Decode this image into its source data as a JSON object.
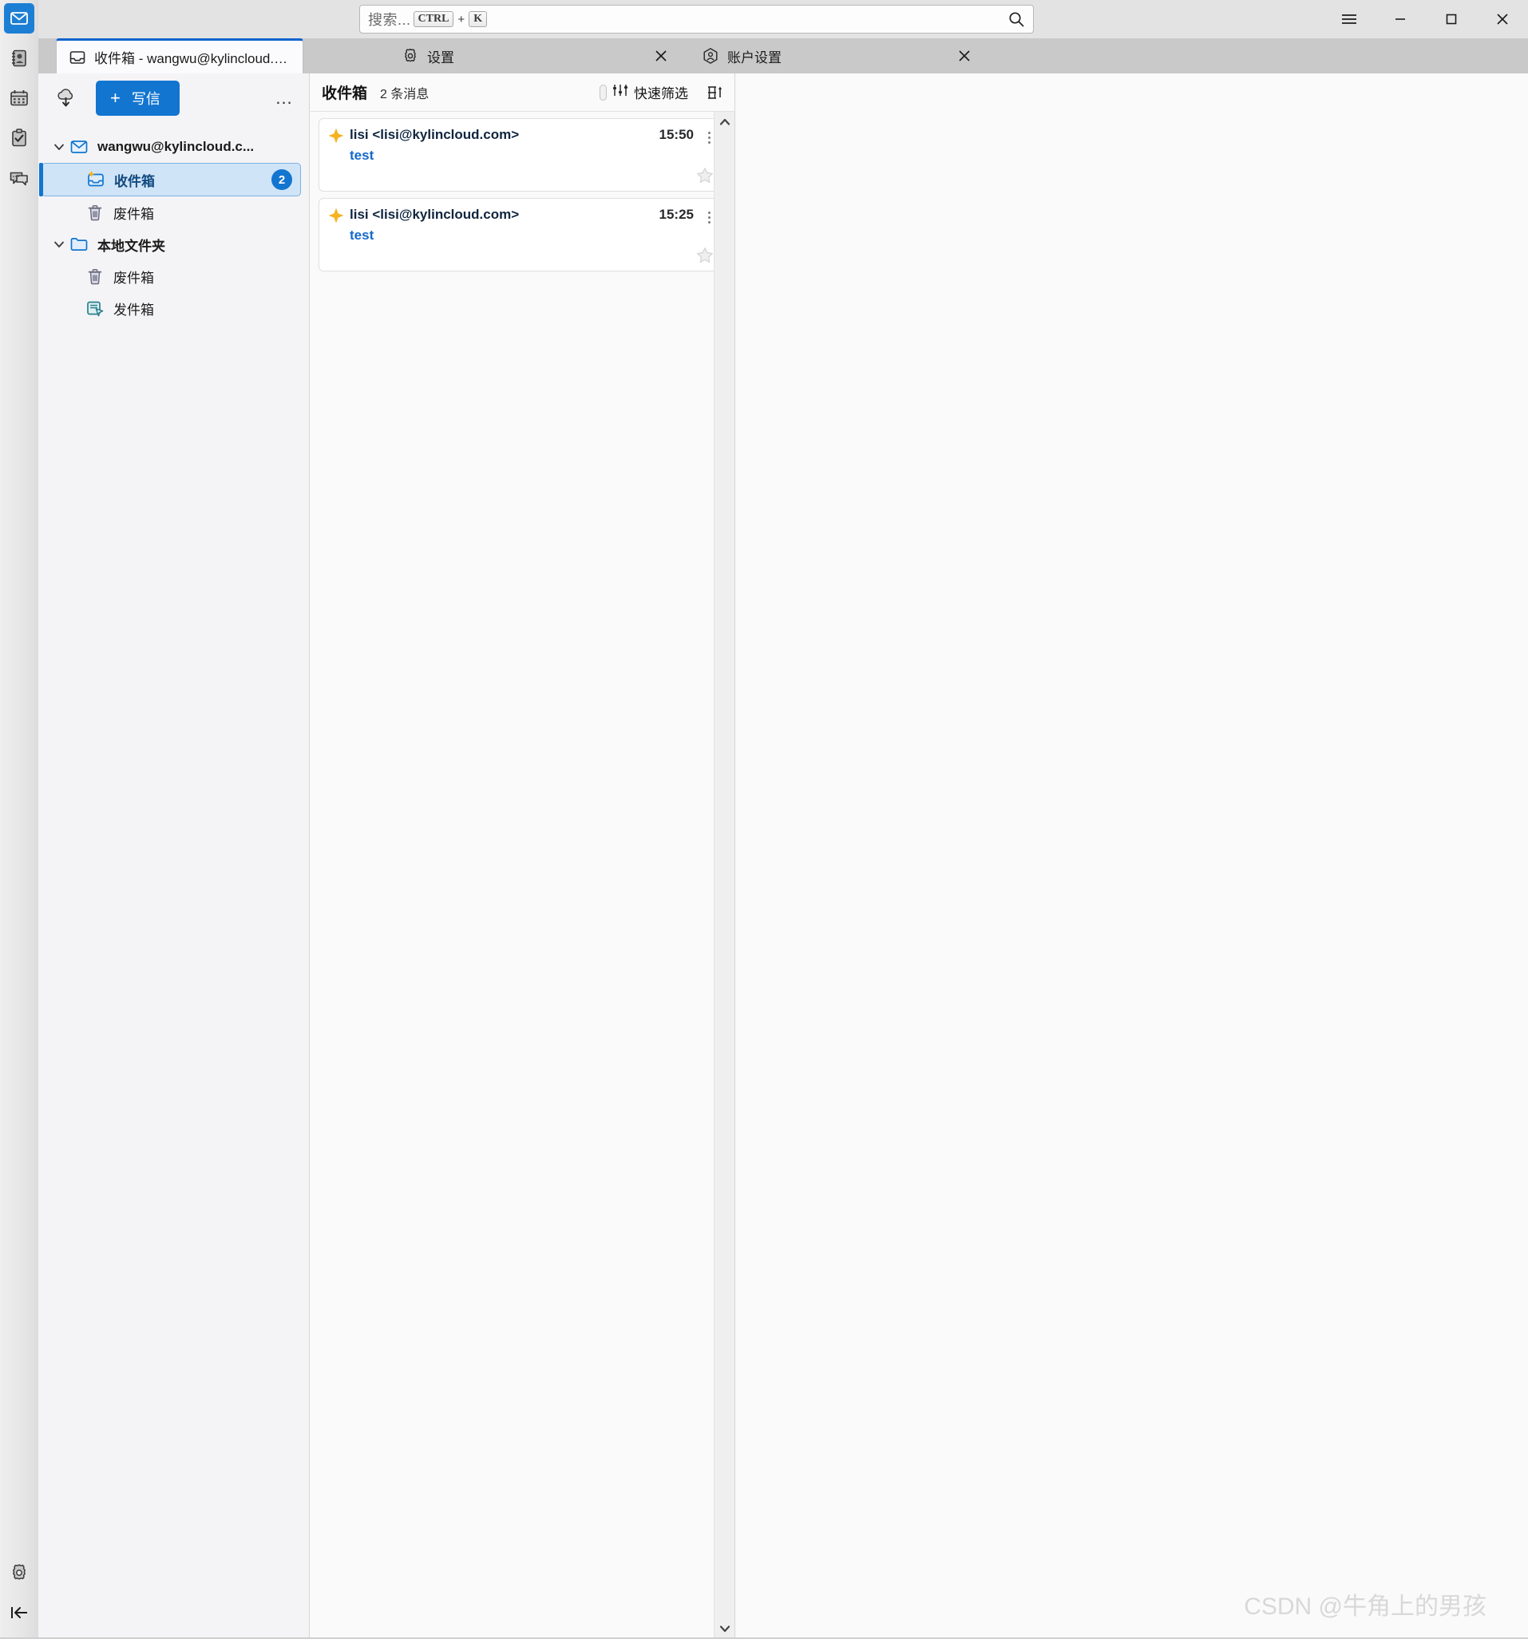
{
  "window": {
    "controls": [
      {
        "name": "menu",
        "glyph": "hamburger"
      },
      {
        "name": "minimize",
        "glyph": "minimize"
      },
      {
        "name": "maximize",
        "glyph": "maximize"
      },
      {
        "name": "close",
        "glyph": "close"
      }
    ]
  },
  "search": {
    "placeholder": "搜索...",
    "shortcut_key1": "CTRL",
    "shortcut_plus": "+",
    "shortcut_key2": "K",
    "icon": "search-icon"
  },
  "rail": {
    "items": [
      {
        "label": "邮件",
        "icon": "mail-icon",
        "active": true
      },
      {
        "label": "通讯录",
        "icon": "address-book-icon",
        "active": false
      },
      {
        "label": "日历",
        "icon": "calendar-icon",
        "active": false
      },
      {
        "label": "任务",
        "icon": "tasks-clipboard-icon",
        "active": false
      },
      {
        "label": "聊天",
        "icon": "chat-bubble-icon",
        "active": false
      }
    ],
    "bottom": [
      {
        "label": "设置",
        "icon": "gear-icon"
      },
      {
        "label": "折叠",
        "icon": "collapse-left-icon"
      }
    ]
  },
  "tabs": [
    {
      "label": "收件箱 - wangwu@kylincloud.com",
      "icon": "inbox-icon",
      "active": true,
      "closable": false
    },
    {
      "label": "设置",
      "icon": "gear-icon",
      "active": false,
      "closable": true
    },
    {
      "label": "账户设置",
      "icon": "account-icon",
      "active": false,
      "closable": true
    }
  ],
  "folder_pane": {
    "get_messages_label": "接收消息",
    "compose_plus": "+",
    "compose_label": "写信",
    "more_label": "...",
    "tree": [
      {
        "label": "wangwu@kylincloud.c...",
        "icon": "mail-account-icon",
        "level": 1,
        "twisty": "expanded",
        "bold": true,
        "selected": false,
        "badge": null
      },
      {
        "label": "收件箱",
        "icon": "inbox-new-icon",
        "level": 2,
        "twisty": null,
        "bold": true,
        "selected": true,
        "badge": "2"
      },
      {
        "label": "废件箱",
        "icon": "trash-icon",
        "level": 2,
        "twisty": null,
        "bold": false,
        "selected": false,
        "badge": null
      },
      {
        "label": "本地文件夹",
        "icon": "folder-icon",
        "level": 1,
        "twisty": "expanded",
        "bold": true,
        "selected": false,
        "badge": null
      },
      {
        "label": "废件箱",
        "icon": "trash-icon",
        "level": 2,
        "twisty": null,
        "bold": false,
        "selected": false,
        "badge": null
      },
      {
        "label": "发件箱",
        "icon": "outbox-icon",
        "level": 2,
        "twisty": null,
        "bold": false,
        "selected": false,
        "badge": null
      }
    ]
  },
  "message_list": {
    "title": "收件箱",
    "count_label": "2 条消息",
    "quick_filter_label": "快速筛选",
    "display_options_label": "显示选项",
    "messages": [
      {
        "sender": "lisi <lisi@kylincloud.com>",
        "time": "15:50",
        "subject": "test",
        "unread": true,
        "starred": false
      },
      {
        "sender": "lisi <lisi@kylincloud.com>",
        "time": "15:25",
        "subject": "test",
        "unread": true,
        "starred": false
      }
    ]
  },
  "watermark": "CSDN @牛角上的男孩",
  "colors": {
    "accent": "#1275d0",
    "tab_active_top": "#0b63ce",
    "selected_row_bg": "#cfe4f7",
    "subject_link": "#1569c7",
    "star_new": "#f5a623",
    "titlebar_bg": "#e3e3e3",
    "tabstrip_bg": "#c9c9c9"
  }
}
